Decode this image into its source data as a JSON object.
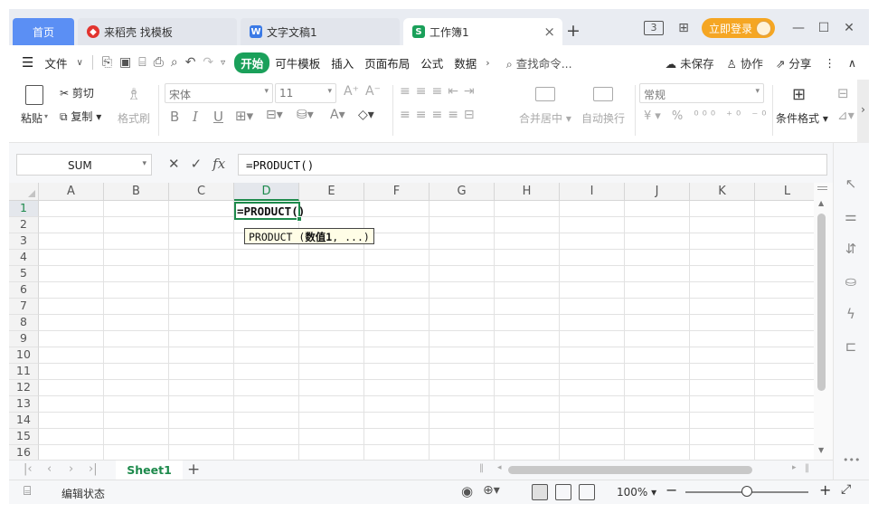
{
  "tabs": {
    "home": "首页",
    "doc1": "来稻壳 找模板",
    "doc2": "文字文稿1",
    "active": "工作簿1",
    "doc1_icon_color": "#e2342f",
    "doc2_icon_color": "#3b7ae6",
    "active_icon_color": "#1aa05a",
    "login": "立即登录"
  },
  "menu": {
    "file": "文件",
    "start": "开始",
    "items": [
      "可牛模板",
      "插入",
      "页面布局",
      "公式",
      "数据"
    ],
    "search": "查找命令...",
    "unsaved": "未保存",
    "collab": "协作",
    "share": "分享"
  },
  "toolbar": {
    "paste": "粘贴",
    "cut": "剪切",
    "copy": "复制",
    "format_painter": "格式刷",
    "font_name": "宋体",
    "font_size": "11",
    "merge_center": "合并居中",
    "wrap": "自动换行",
    "number_format": "常规",
    "cond_format": "条件格式"
  },
  "formula_bar": {
    "name_box": "SUM",
    "formula": "=PRODUCT()"
  },
  "grid": {
    "columns": [
      "A",
      "B",
      "C",
      "D",
      "E",
      "F",
      "G",
      "H",
      "I",
      "J",
      "K",
      "L"
    ],
    "selected_column": "D",
    "rows": [
      "1",
      "2",
      "3",
      "4",
      "5",
      "6",
      "7",
      "8",
      "9",
      "10",
      "11",
      "12",
      "13",
      "14",
      "15",
      "16"
    ],
    "selected_row": "1",
    "active_cell_value": "=PRODUCT()",
    "tooltip_func": "PRODUCT (",
    "tooltip_arg": "数值1",
    "tooltip_rest": ", ...)"
  },
  "sheets": {
    "active": "Sheet1"
  },
  "status": {
    "mode": "编辑状态",
    "zoom": "100%"
  },
  "colors": {
    "accent_green": "#1e8a4c",
    "home_tab_blue": "#5b8ff4",
    "login_orange": "#f5a623"
  }
}
